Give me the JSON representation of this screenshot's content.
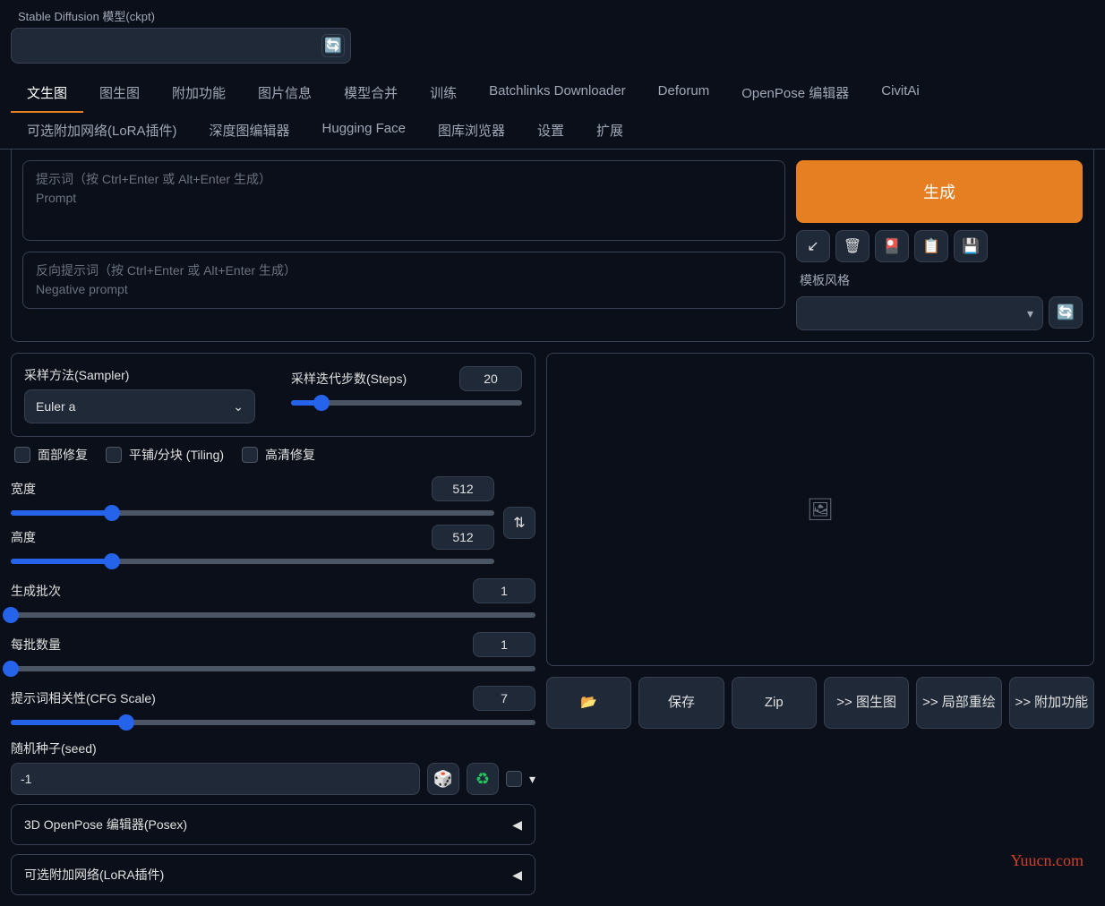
{
  "model": {
    "label": "Stable Diffusion 模型(ckpt)",
    "value": ""
  },
  "tabs": [
    "文生图",
    "图生图",
    "附加功能",
    "图片信息",
    "模型合并",
    "训练",
    "Batchlinks Downloader",
    "Deforum",
    "OpenPose 编辑器",
    "CivitAi",
    "可选附加网络(LoRA插件)",
    "深度图编辑器",
    "Hugging Face",
    "图库浏览器",
    "设置",
    "扩展"
  ],
  "prompt": {
    "placeholder_cn": "提示词（按 Ctrl+Enter 或 Alt+Enter 生成）",
    "placeholder_en": "Prompt"
  },
  "neg_prompt": {
    "placeholder_cn": "反向提示词（按 Ctrl+Enter 或 Alt+Enter 生成）",
    "placeholder_en": "Negative prompt"
  },
  "generate": "生成",
  "style": {
    "label": "模板风格",
    "value": ""
  },
  "sampler": {
    "label": "采样方法(Sampler)",
    "value": "Euler a"
  },
  "steps": {
    "label": "采样迭代步数(Steps)",
    "value": 20,
    "pct": 13
  },
  "checks": {
    "face": "面部修复",
    "tiling": "平铺/分块 (Tiling)",
    "hires": "高清修复"
  },
  "width": {
    "label": "宽度",
    "value": 512,
    "pct": 21
  },
  "height": {
    "label": "高度",
    "value": 512,
    "pct": 21
  },
  "batch_count": {
    "label": "生成批次",
    "value": 1,
    "pct": 0
  },
  "batch_size": {
    "label": "每批数量",
    "value": 1,
    "pct": 0
  },
  "cfg": {
    "label": "提示词相关性(CFG Scale)",
    "value": 7,
    "pct": 22
  },
  "seed": {
    "label": "随机种子(seed)",
    "value": "-1"
  },
  "accordions": [
    "3D OpenPose 编辑器(Posex)",
    "可选附加网络(LoRA插件)"
  ],
  "out_btns": {
    "folder": "📂",
    "save": "保存",
    "zip": "Zip",
    "img2img": ">> 图生图",
    "inpaint": ">> 局部重绘",
    "extras": ">> 附加功能"
  },
  "watermark": "Yuucn.com"
}
